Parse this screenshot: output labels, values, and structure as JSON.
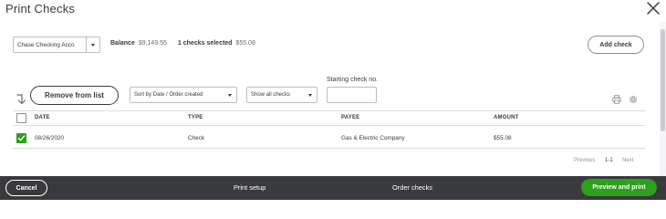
{
  "dialog": {
    "title": "Print Checks"
  },
  "toolbar": {
    "account_value": "Chase Checking Acco",
    "balance_label": "Balance",
    "balance_value": "$9,149.55",
    "selected_label": "1 checks selected",
    "selected_value": "$55.08",
    "add_check_label": "Add check"
  },
  "filters": {
    "remove_label": "Remove from list",
    "sort_value": "Sort by Date / Order created",
    "show_value": "Show all checks",
    "starting_check_label": "Starting check no.",
    "starting_check_value": ""
  },
  "table": {
    "columns": [
      "DATE",
      "TYPE",
      "PAYEE",
      "AMOUNT"
    ],
    "rows": [
      {
        "date": "08/26/2020",
        "type": "Check",
        "payee": "Gas & Electric Company",
        "amount": "$55.08",
        "checked": true
      }
    ]
  },
  "pagination": {
    "previous": "Previous",
    "range": "1-1",
    "next": "Next"
  },
  "footer": {
    "cancel_label": "Cancel",
    "print_setup_label": "Print setup",
    "order_checks_label": "Order checks",
    "preview_label": "Preview and print"
  },
  "colors": {
    "accent_green": "#2ca01c",
    "footer_bg": "#393a3d",
    "text": "#393a3d"
  },
  "icons": [
    "close-icon",
    "return-arrow-icon",
    "print-icon",
    "gear-icon",
    "chevron-down-icon",
    "checkmark-icon"
  ]
}
